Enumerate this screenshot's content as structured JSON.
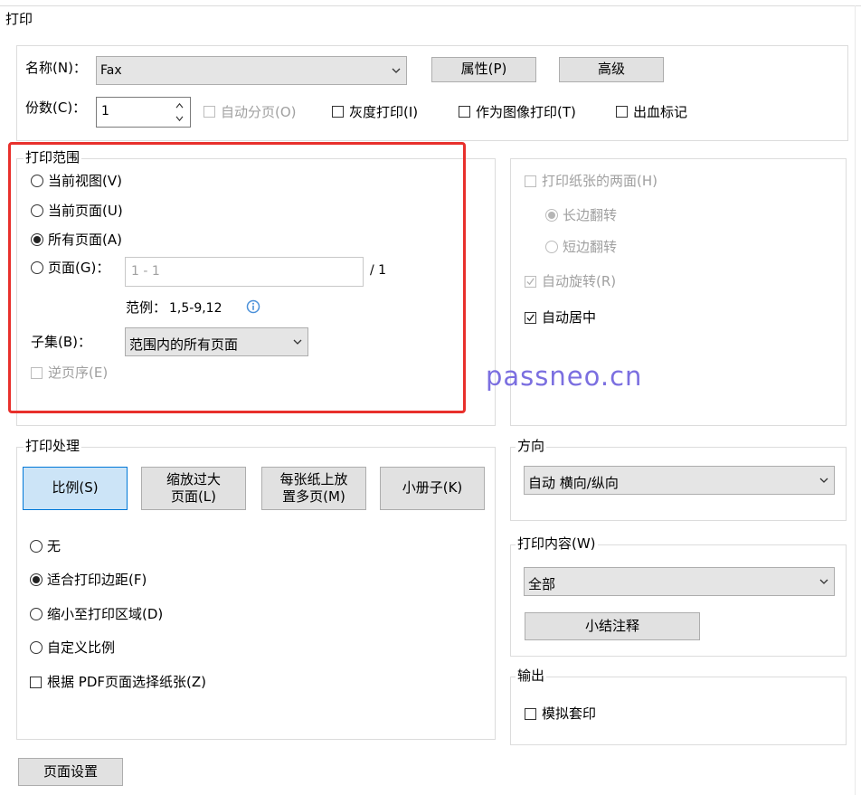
{
  "window": {
    "title": "打印"
  },
  "printer": {
    "name_label": "名称(N)：",
    "name_value": "Fax",
    "properties_button": "属性(P)",
    "advanced_button": "高级",
    "copies_label": "份数(C)：",
    "copies_value": "1",
    "collate_label": "自动分页(O)",
    "collate_checked": false,
    "grayscale_label": "灰度打印(I)",
    "grayscale_checked": false,
    "as_image_label": "作为图像打印(T)",
    "as_image_checked": false,
    "bleed_marks_label": "出血标记",
    "bleed_marks_checked": false
  },
  "print_range": {
    "title": "打印范围",
    "current_view": "当前视图(V)",
    "current_page": "当前页面(U)",
    "all_pages": "所有页面(A)",
    "selected": "all_pages",
    "pages_label": "页面(G)：",
    "pages_placeholder": "1 - 1",
    "pages_total": "/ 1",
    "example_label": "范例：",
    "example_value": "1,5-9,12",
    "subset_label": "子集(B)：",
    "subset_value": "范围内的所有页面",
    "reverse_label": "逆页序(E)",
    "reverse_checked": false
  },
  "duplex": {
    "both_sides_label": "打印纸张的两面(H)",
    "long_edge_label": "长边翻转",
    "short_edge_label": "短边翻转",
    "auto_rotate_label": "自动旋转(R)",
    "auto_rotate_checked": true,
    "auto_center_label": "自动居中",
    "auto_center_checked": true
  },
  "watermark": {
    "text": "passneo.cn"
  },
  "handling": {
    "title": "打印处理",
    "buttons": [
      "比例(S)",
      "缩放过大\n页面(L)",
      "每张纸上放\n置多页(M)",
      "小册子(K)"
    ],
    "selected_button": "比例(S)",
    "options": [
      "无",
      "适合打印边距(F)",
      "缩小至打印区域(D)",
      "自定义比例"
    ],
    "selected_option": "适合打印边距(F)",
    "paper_by_pdf_label": "根据 PDF页面选择纸张(Z)",
    "paper_by_pdf_checked": false
  },
  "orientation": {
    "title": "方向",
    "value": "自动 横向/纵向"
  },
  "content": {
    "title": "打印内容(W)",
    "value": "全部",
    "summarize_button": "小结注释"
  },
  "output": {
    "title": "输出",
    "simulate_overprint_label": "模拟套印",
    "simulate_overprint_checked": false
  },
  "page_setup_button": "页面设置",
  "colors": {
    "highlight_border": "#e8302c",
    "watermark": "#7b6fe0",
    "selected_button_bg": "#cce4f7",
    "info_icon": "#4a90d9"
  }
}
